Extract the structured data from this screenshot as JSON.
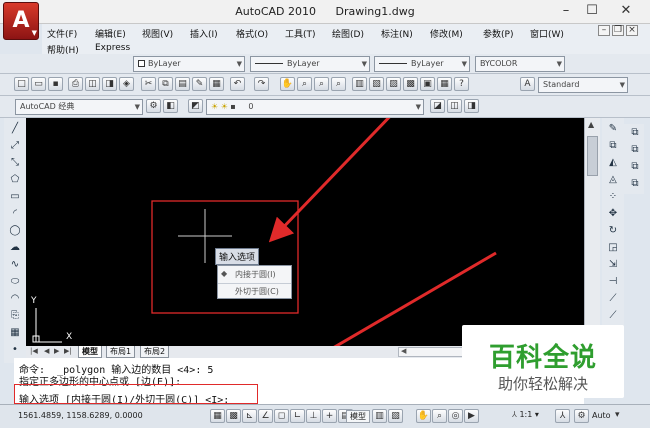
{
  "window": {
    "app_name": "AutoCAD 2010",
    "document": "Drawing1.dwg",
    "app_button": "A"
  },
  "menu": [
    "文件(F)",
    "编辑(E)",
    "视图(V)",
    "插入(I)",
    "格式(O)",
    "工具(T)",
    "绘图(D)",
    "标注(N)",
    "修改(M)",
    "参数(P)",
    "窗口(W)",
    "帮助(H)",
    "Express"
  ],
  "properties": {
    "color": "ByLayer",
    "linetype": "ByLayer",
    "lineweight": "ByLayer",
    "plotstyle": "BYCOLOR"
  },
  "styles": {
    "text_style": "Standard"
  },
  "workspace": {
    "name": "AutoCAD 经典",
    "layer": "0"
  },
  "canvas": {
    "ucs_y": "Y",
    "ucs_x": "X"
  },
  "dynamic_input": {
    "title": "输入选项",
    "options": [
      {
        "label": "内接于圆(I)",
        "selected": true
      },
      {
        "label": "外切于圆(C)",
        "selected": false
      }
    ]
  },
  "layout_tabs": [
    "模型",
    "布局1",
    "布局2"
  ],
  "command_history": [
    "命令:  _polygon 输入边的数目 <4>: 5",
    "指定正多边形的中心点或 [边(E)]:"
  ],
  "command_prompt": "输入选项 [内接于圆(I)/外切于圆(C)] <I>:",
  "status": {
    "coordinates": "1561.4859, 1158.6289, 0.0000",
    "model_label": "模型",
    "annotation_scale": "1:1",
    "auto_label": "Auto"
  },
  "watermark": {
    "title": "百科全说",
    "subtitle": "助你轻松解决"
  },
  "colors": {
    "canvas": "#000000",
    "annotation_red": "#e02a2a",
    "crosshair": "#cccccc"
  }
}
